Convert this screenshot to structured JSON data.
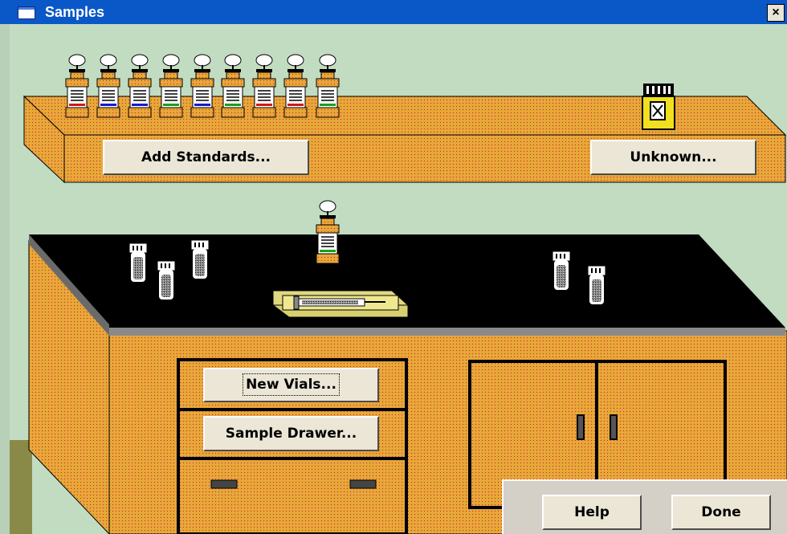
{
  "window": {
    "title": "Samples",
    "close_label": "×"
  },
  "shelf": {
    "standards_button": "Add Standards...",
    "unknown_button": "Unknown..."
  },
  "cabinet": {
    "new_vials_button": "New Vials...",
    "sample_drawer_button": "Sample Drawer..."
  },
  "footer": {
    "help_button": "Help",
    "done_button": "Done"
  },
  "standards": {
    "count": 9,
    "stripe_colors": [
      "#d01818",
      "#1818d0",
      "#1818d0",
      "#18a018",
      "#1818d0",
      "#18a018",
      "#d01818",
      "#d01818",
      "#18a018"
    ]
  },
  "colors": {
    "wall": "#c2dcc2",
    "wood": "#e8a640",
    "countertop": "#000000",
    "titlebar": "#0a58c8"
  }
}
